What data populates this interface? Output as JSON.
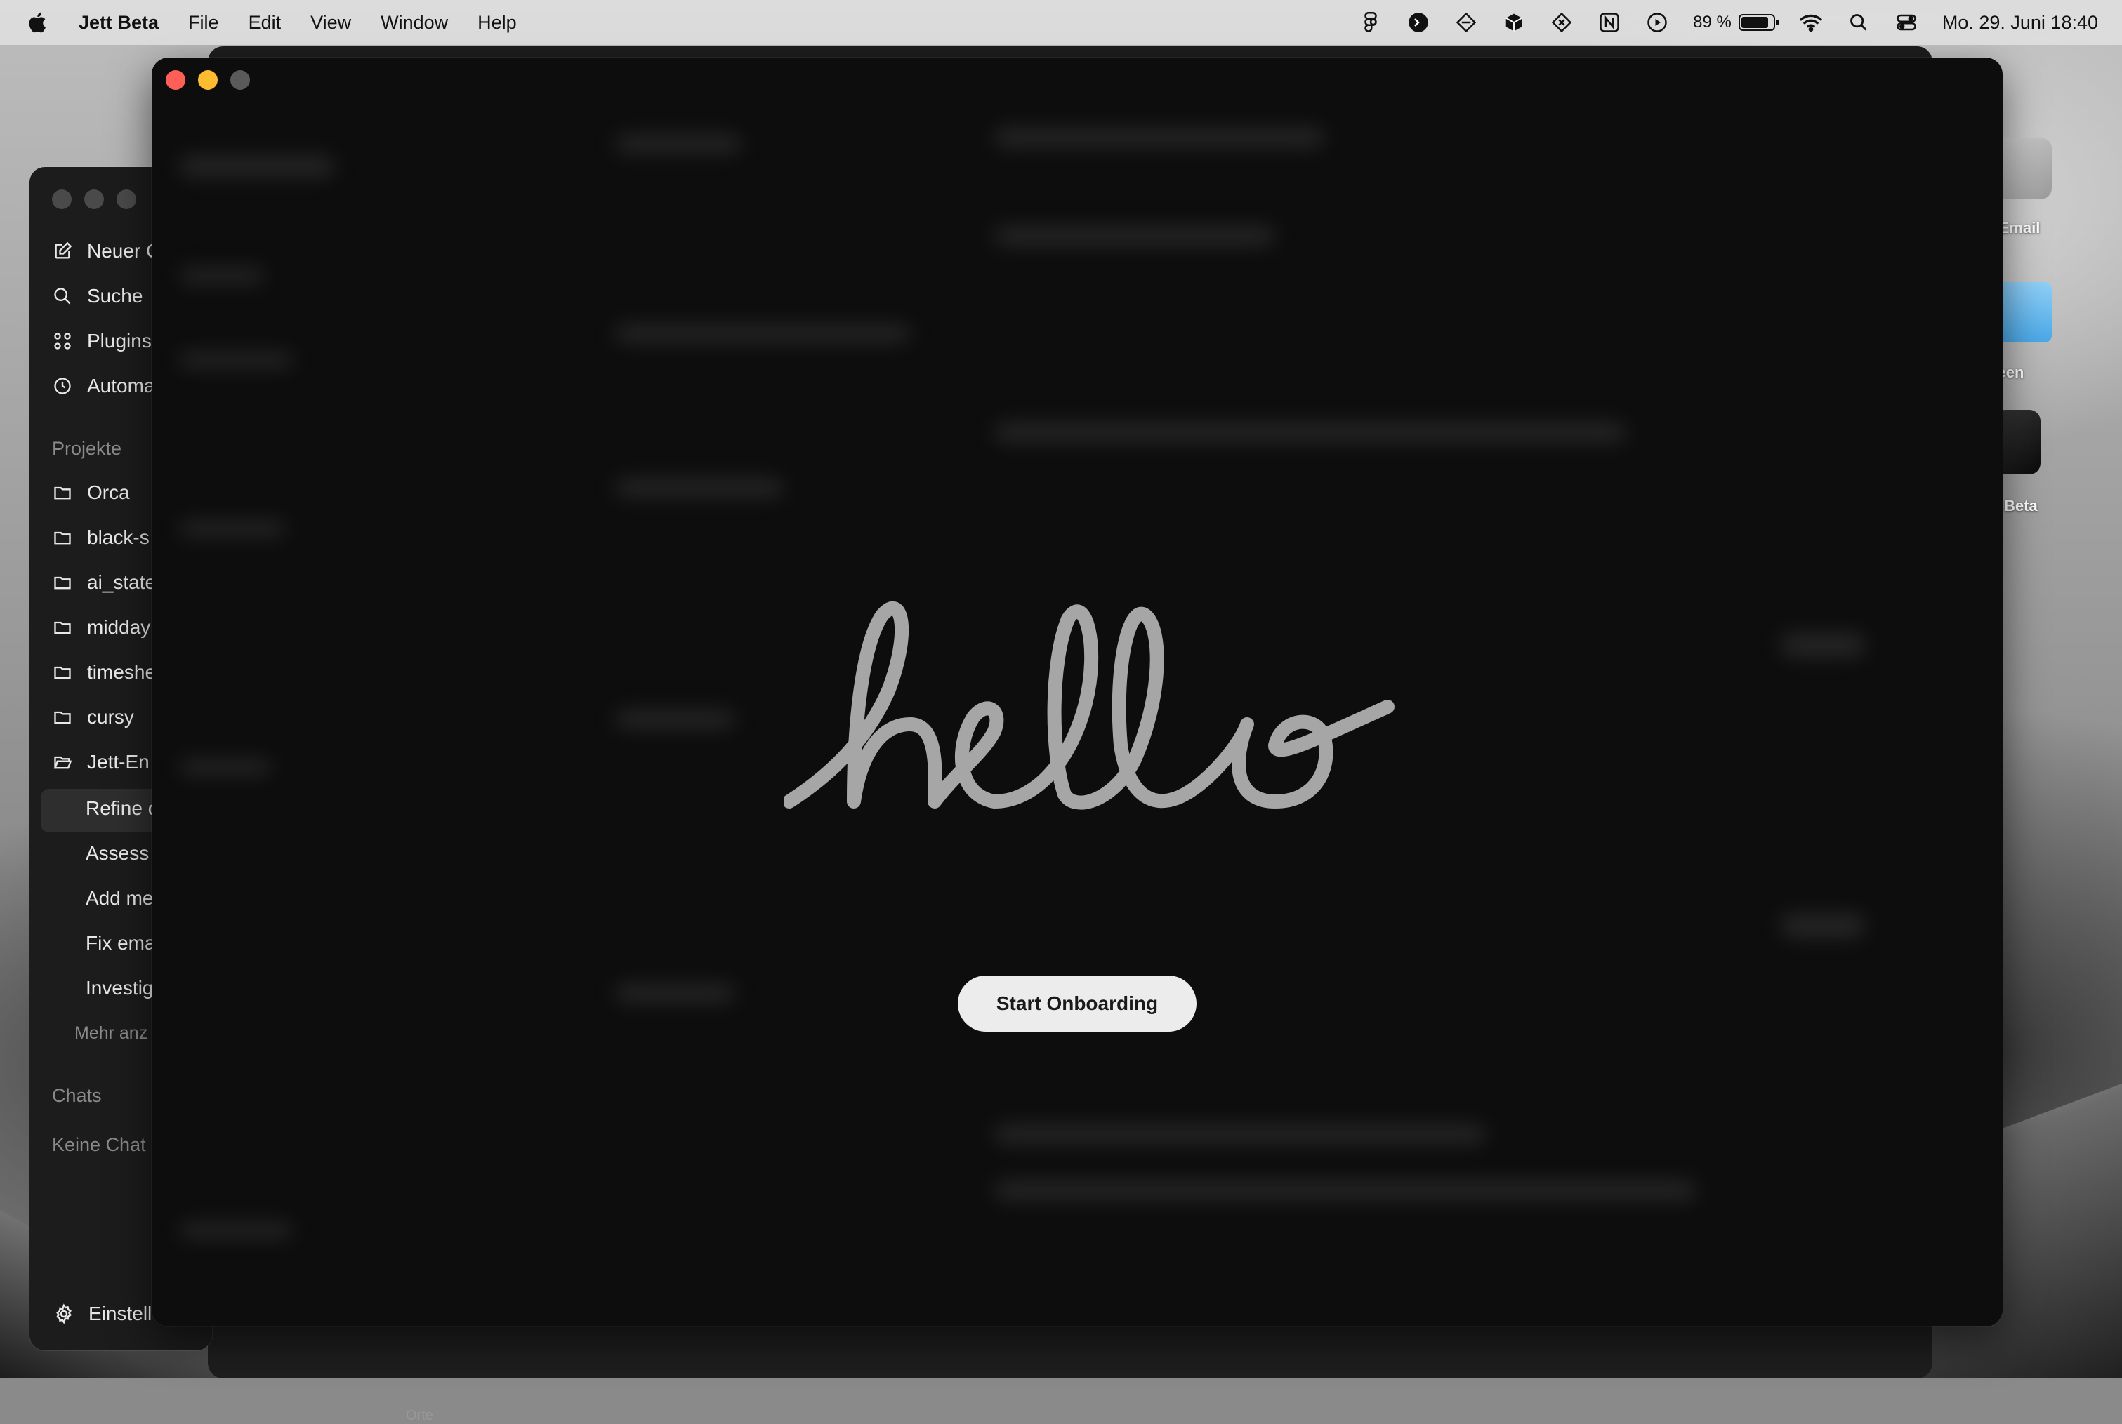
{
  "menubar": {
    "app_name": "Jett Beta",
    "menus": [
      "File",
      "Edit",
      "View",
      "Window",
      "Help"
    ],
    "battery_percent": "89 %",
    "battery_level": 0.89,
    "clock": "Mo. 29. Juni 18:40"
  },
  "desktop_icons": [
    {
      "label": "t-Email"
    },
    {
      "label": "reen"
    },
    {
      "label": "Beta"
    }
  ],
  "sidebar": {
    "top_items": [
      {
        "label": "Neuer C",
        "icon": "compose-icon"
      },
      {
        "label": "Suche",
        "icon": "search-icon"
      },
      {
        "label": "Plugins",
        "icon": "plugins-icon"
      },
      {
        "label": "Automa",
        "icon": "clock-icon"
      }
    ],
    "projects_heading": "Projekte",
    "projects": [
      "Orca",
      "black-s",
      "ai_state",
      "midday",
      "timeshe",
      "cursy",
      "Jett-En"
    ],
    "sub_items": [
      "Refine c",
      "Assess",
      "Add me",
      "Fix ema",
      "Investig"
    ],
    "more_label": "Mehr anz",
    "chats_heading": "Chats",
    "no_chats": "Keine Chat",
    "settings_label": "Einstell"
  },
  "back_window": {
    "places_label": "Orte"
  },
  "onboarding": {
    "greeting": "hello",
    "start_button": "Start Onboarding"
  },
  "colors": {
    "close": "#ff5f57",
    "minimize": "#febc2e",
    "zoom_inactive": "#5a5a5a",
    "hello_stroke": "#a6a6a6",
    "button_bg": "#ececec"
  }
}
